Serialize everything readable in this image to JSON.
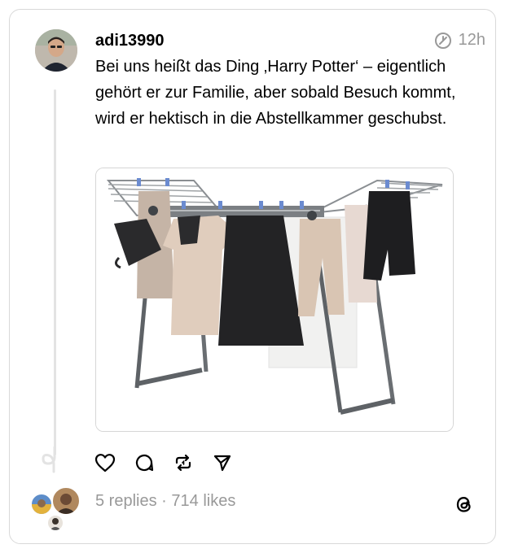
{
  "post": {
    "username": "adi13990",
    "time": "12h",
    "text": "Bei uns heißt das Ding ‚Harry Potter‘ – eigentlich gehört er zur Familie, aber sobald Besuch kommt, wird er hektisch in die Abstellkammer geschubst.",
    "image_alt": "Foldable drying rack with laundry"
  },
  "actions": {
    "like_icon": "heart-icon",
    "reply_icon": "comment-icon",
    "repost_icon": "repost-icon",
    "share_icon": "send-icon"
  },
  "footer": {
    "replies": "5 replies",
    "separator": "·",
    "likes": "714 likes"
  },
  "icons": {
    "edited": "edited-clock-icon",
    "brand": "threads-logo"
  }
}
